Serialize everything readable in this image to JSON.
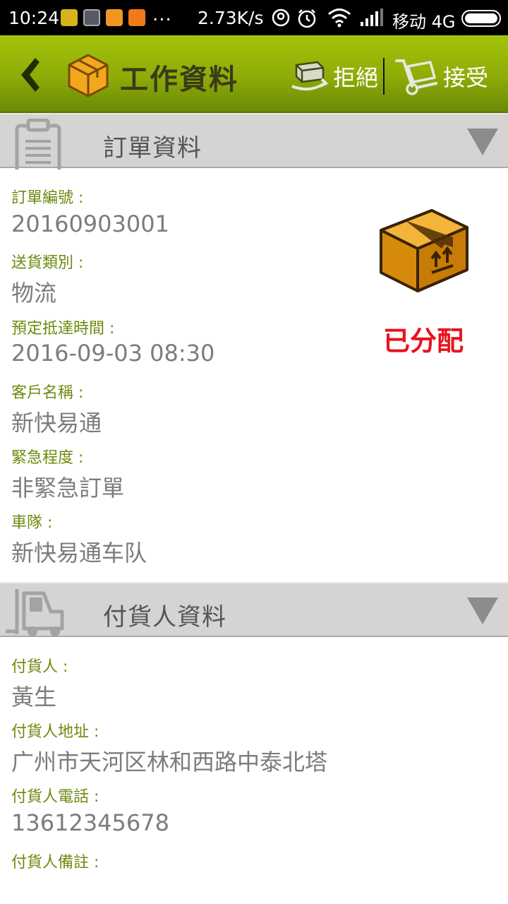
{
  "status_bar": {
    "time": "10:24",
    "network_speed": "2.73K/s",
    "carrier": "移动 4G",
    "notification_more": "..."
  },
  "app_bar": {
    "title": "工作資料",
    "reject_label": "拒絕",
    "accept_label": "接受",
    "accent_color": "#9cb90a"
  },
  "order_section": {
    "title": "訂單資料",
    "status": "已分配",
    "status_color": "#e8121d",
    "fields": [
      {
        "label": "訂單編號 :",
        "value": "20160903001"
      },
      {
        "label": "送貨類別 :",
        "value": "物流"
      },
      {
        "label": "預定抵達時間 :",
        "value": "2016-09-03 08:30"
      },
      {
        "label": "客戶名稱 :",
        "value": "新快易通"
      },
      {
        "label": "緊急程度 :",
        "value": "非緊急訂單"
      },
      {
        "label": "車隊 :",
        "value": "新快易通车队"
      }
    ]
  },
  "shipper_section": {
    "title": "付貨人資料",
    "fields": [
      {
        "label": "付貨人 :",
        "value": "黃生"
      },
      {
        "label": "付貨人地址 :",
        "value": "广州市天河区林和西路中泰北塔"
      },
      {
        "label": "付貨人電話 :",
        "value": "13612345678"
      },
      {
        "label": "付貨人備註 :",
        "value": ""
      }
    ]
  }
}
